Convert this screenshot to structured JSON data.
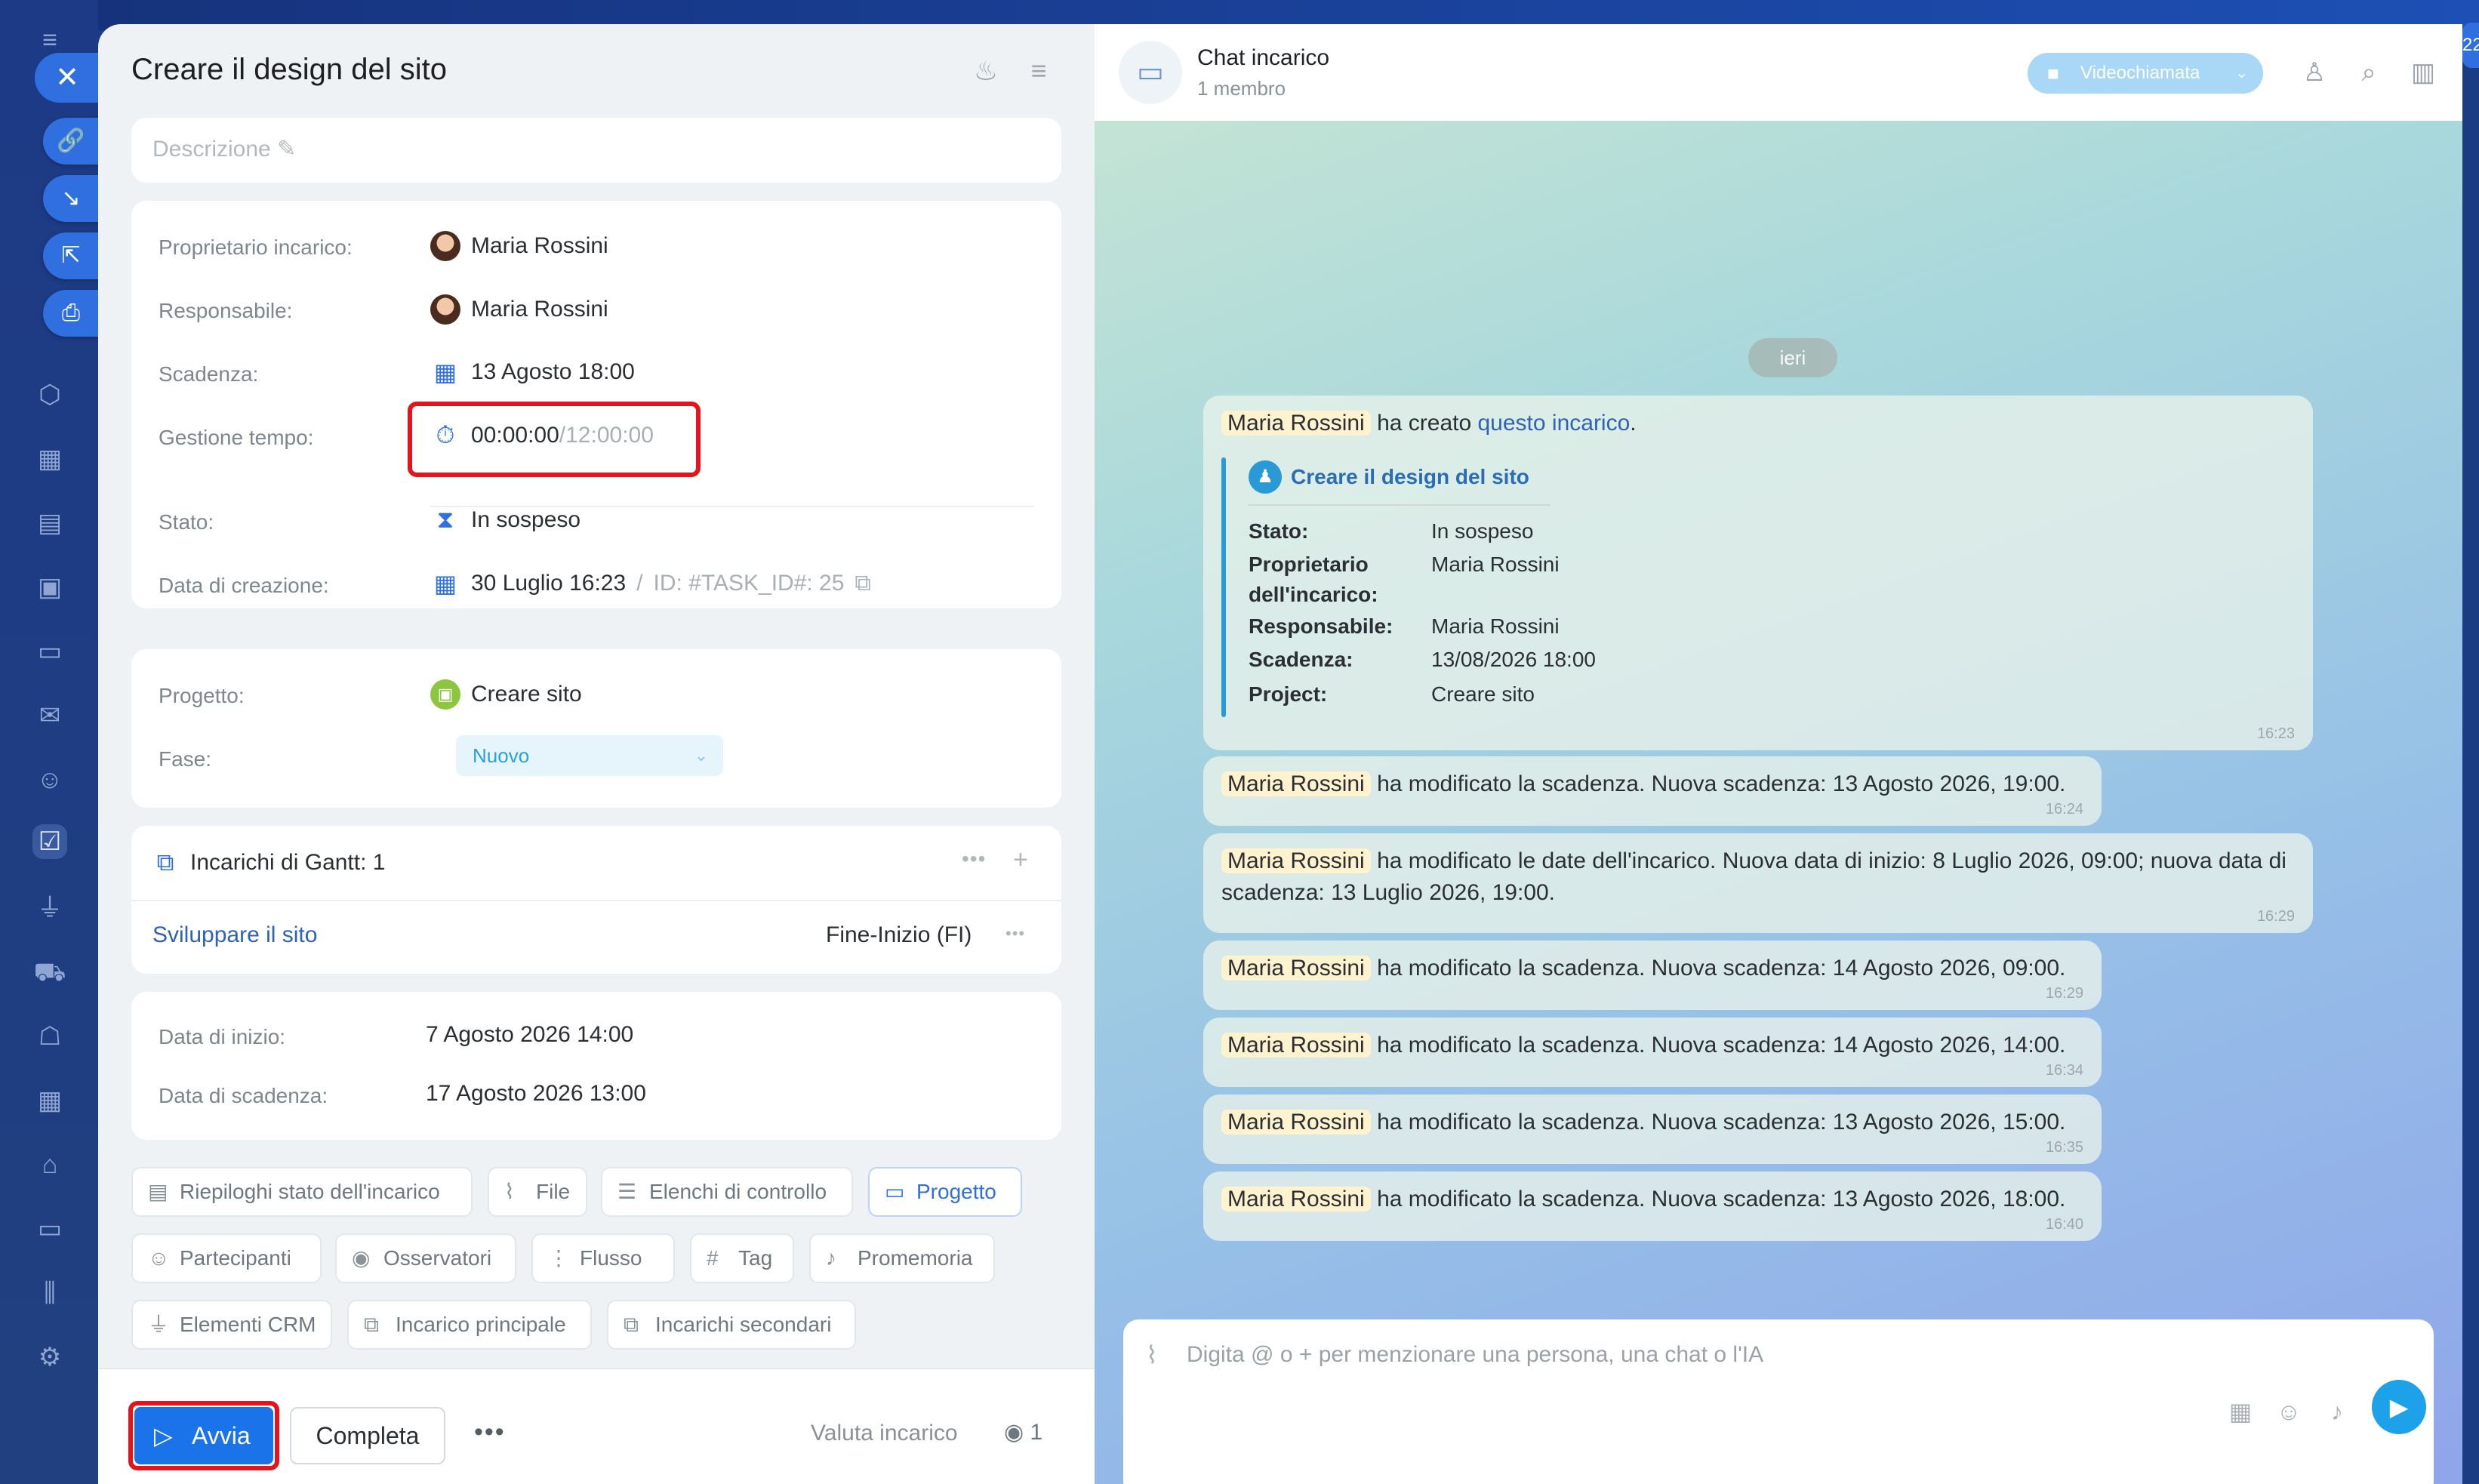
{
  "task": {
    "title": "Creare il design del sito",
    "description_placeholder": "Descrizione",
    "fields": {
      "owner_label": "Proprietario incarico:",
      "owner": "Maria Rossini",
      "responsible_label": "Responsabile:",
      "responsible": "Maria Rossini",
      "deadline_label": "Scadenza:",
      "deadline": "13 Agosto 18:00",
      "time_label": "Gestione tempo:",
      "time_spent": "00:00:00",
      "time_sep": "/",
      "time_est": "12:00:00",
      "status_label": "Stato:",
      "status": "In sospeso",
      "created_label": "Data di creazione:",
      "created": "30 Luglio 16:23",
      "id_sep": "/",
      "id": "ID: #TASK_ID#: 25"
    },
    "project": {
      "label": "Progetto:",
      "value": "Creare sito",
      "phase_label": "Fase:",
      "phase": "Nuovo"
    },
    "gantt": {
      "title": "Incarichi di Gantt: 1",
      "link": "Sviluppare il sito",
      "type": "Fine-Inizio (FI)"
    },
    "dates": {
      "start_label": "Data di inizio:",
      "start": "7 Agosto 2026 14:00",
      "due_label": "Data di scadenza:",
      "due": "17 Agosto 2026 13:00"
    },
    "chips": [
      "Riepiloghi stato dell'incarico",
      "File",
      "Elenchi di controllo",
      "Progetto",
      "Partecipanti",
      "Osservatori",
      "Flusso",
      "Tag",
      "Promemoria",
      "Elementi CRM",
      "Incarico principale",
      "Incarichi secondari"
    ],
    "footer": {
      "start": "Avvia",
      "complete": "Completa",
      "more": "•••",
      "rate": "Valuta incarico",
      "views": "1"
    }
  },
  "chat": {
    "title": "Chat incarico",
    "subtitle": "1 membro",
    "video_button": "Videochiamata",
    "date_divider": "ieri",
    "first": {
      "who": "Maria Rossini",
      "text": "ha creato",
      "link": "questo incarico",
      "dot": ".",
      "card_title": "Creare il design del sito",
      "rows": [
        {
          "k": "Stato:",
          "v": "In sospeso"
        },
        {
          "k": "Proprietario dell'incarico:",
          "v": "Maria Rossini"
        },
        {
          "k": "Responsabile:",
          "v": "Maria Rossini"
        },
        {
          "k": "Scadenza:",
          "v": "13/08/2026 18:00"
        },
        {
          "k": "Project:",
          "v": "Creare sito"
        }
      ],
      "time": "16:23"
    },
    "messages": [
      {
        "who": "Maria Rossini",
        "text": "ha modificato la scadenza. Nuova scadenza: 13 Agosto 2026, 19:00.",
        "time": "16:24"
      },
      {
        "who": "Maria Rossini",
        "text": "ha modificato le date dell'incarico. Nuova data di inizio: 8 Luglio 2026, 09:00; nuova data di scadenza: 13 Luglio 2026, 19:00.",
        "time": "16:29"
      },
      {
        "who": "Maria Rossini",
        "text": "ha modificato la scadenza. Nuova scadenza: 14 Agosto 2026, 09:00.",
        "time": "16:29"
      },
      {
        "who": "Maria Rossini",
        "text": "ha modificato la scadenza. Nuova scadenza: 14 Agosto 2026, 14:00.",
        "time": "16:34"
      },
      {
        "who": "Maria Rossini",
        "text": "ha modificato la scadenza. Nuova scadenza: 13 Agosto 2026, 15:00.",
        "time": "16:35"
      },
      {
        "who": "Maria Rossini",
        "text": "ha modificato la scadenza. Nuova scadenza: 13 Agosto 2026, 18:00.",
        "time": "16:40"
      }
    ],
    "input_placeholder": "Digita @ o + per menzionare una persona, una chat o l'IA"
  }
}
